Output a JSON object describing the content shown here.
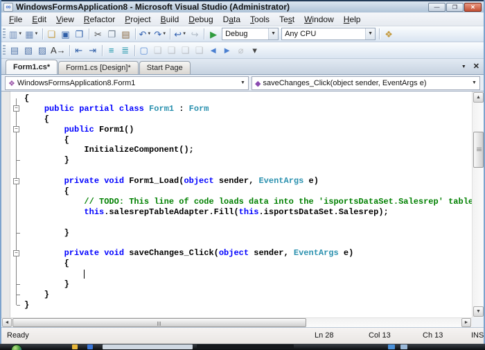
{
  "window": {
    "title": "WindowsFormsApplication8 - Microsoft Visual Studio (Administrator)",
    "logo_glyph": "∞",
    "controls": [
      {
        "name": "minimize-button",
        "glyph": "—"
      },
      {
        "name": "restore-button",
        "glyph": "❐"
      },
      {
        "name": "close-button",
        "glyph": "✕"
      }
    ]
  },
  "menubar": {
    "items": [
      {
        "label": "File",
        "u": 0
      },
      {
        "label": "Edit",
        "u": 0
      },
      {
        "label": "View",
        "u": 0
      },
      {
        "label": "Refactor",
        "u": 0
      },
      {
        "label": "Project",
        "u": 0
      },
      {
        "label": "Build",
        "u": 0
      },
      {
        "label": "Debug",
        "u": 0
      },
      {
        "label": "Data",
        "u": 1
      },
      {
        "label": "Tools",
        "u": 0
      },
      {
        "label": "Test",
        "u": 2
      },
      {
        "label": "Window",
        "u": 0
      },
      {
        "label": "Help",
        "u": 0
      }
    ]
  },
  "toolbar_main": {
    "items": [
      {
        "kind": "grip"
      },
      {
        "name": "new-project-button",
        "glyph": "▥",
        "color": "#6f8cb8",
        "dd": true
      },
      {
        "name": "add-new-item-button",
        "glyph": "▦",
        "color": "#6f8cb8",
        "dd": true
      },
      {
        "kind": "sep"
      },
      {
        "name": "open-file-button",
        "glyph": "❏",
        "color": "#c49a3e"
      },
      {
        "name": "save-button",
        "glyph": "▣",
        "color": "#2f5fa8"
      },
      {
        "name": "save-all-button",
        "glyph": "❐",
        "color": "#2f5fa8"
      },
      {
        "kind": "sep"
      },
      {
        "name": "cut-button",
        "glyph": "✂",
        "color": "#4a4a4a"
      },
      {
        "name": "copy-button",
        "glyph": "❐",
        "color": "#6a7a8a"
      },
      {
        "name": "paste-button",
        "glyph": "▤",
        "color": "#8a6a42"
      },
      {
        "kind": "sep"
      },
      {
        "name": "undo-button",
        "glyph": "↶",
        "color": "#2f5fb0",
        "dd": true
      },
      {
        "name": "redo-button",
        "glyph": "↷",
        "color": "#2f5fb0",
        "dd": true
      },
      {
        "kind": "sep"
      },
      {
        "name": "navigate-backward-button",
        "glyph": "↩",
        "color": "#2f5fb0",
        "dd": true
      },
      {
        "name": "navigate-forward-button",
        "glyph": "↪",
        "color": "#6a7a8a",
        "disabled": true
      },
      {
        "kind": "sep"
      },
      {
        "name": "start-debugging-button",
        "glyph": "▶",
        "color": "#2e9b3e"
      },
      {
        "kind": "combo",
        "name": "solution-configurations-combo",
        "value": "Debug",
        "width": 82
      },
      {
        "kind": "combo",
        "name": "solution-platforms-combo",
        "value": "Any CPU",
        "width": 136
      },
      {
        "kind": "sep"
      },
      {
        "name": "find-in-files-button",
        "glyph": "❖",
        "color": "#c49a3e"
      }
    ],
    "dd_glyph": "▼"
  },
  "toolbar_text_editor": {
    "items": [
      {
        "kind": "grip"
      },
      {
        "name": "display-member-list-button",
        "glyph": "▤",
        "color": "#5577aa"
      },
      {
        "name": "display-word-completion-button",
        "glyph": "▧",
        "color": "#5577aa"
      },
      {
        "name": "display-quick-info-button",
        "glyph": "▨",
        "color": "#5577aa"
      },
      {
        "name": "display-parameter-info-button",
        "glyph": "A→",
        "color": "#333333"
      },
      {
        "kind": "sep"
      },
      {
        "name": "decrease-indent-button",
        "glyph": "⇤",
        "color": "#2f5fa8"
      },
      {
        "name": "increase-indent-button",
        "glyph": "⇥",
        "color": "#2f5fa8"
      },
      {
        "kind": "sep"
      },
      {
        "name": "comment-selection-button",
        "glyph": "≡",
        "color": "#1a93a8"
      },
      {
        "name": "uncomment-selection-button",
        "glyph": "≣",
        "color": "#1a93a8"
      },
      {
        "kind": "sep"
      },
      {
        "name": "toggle-bookmark-button",
        "glyph": "▢",
        "color": "#5b8dd6"
      },
      {
        "name": "previous-bookmark-button",
        "glyph": "❑",
        "color": "#8a8a8a",
        "disabled": true
      },
      {
        "name": "next-bookmark-button",
        "glyph": "❑",
        "color": "#8a8a8a",
        "disabled": true
      },
      {
        "name": "previous-bookmark-in-folder-button",
        "glyph": "❑",
        "color": "#8a8a8a",
        "disabled": true
      },
      {
        "name": "next-bookmark-in-folder-button",
        "glyph": "❑",
        "color": "#8a8a8a",
        "disabled": true
      },
      {
        "name": "previous-bookmark-in-document-button",
        "glyph": "◄",
        "color": "#4a7fd0"
      },
      {
        "name": "next-bookmark-in-document-button",
        "glyph": "►",
        "color": "#4a7fd0"
      },
      {
        "name": "clear-bookmarks-button",
        "glyph": "⌀",
        "color": "#8a8a8a",
        "disabled": true
      },
      {
        "name": "toolbar-options-button",
        "glyph": "▾",
        "color": "#444444"
      }
    ]
  },
  "tabs": {
    "items": [
      {
        "label": "Form1.cs*",
        "active": true
      },
      {
        "label": "Form1.cs [Design]*",
        "active": false
      },
      {
        "label": "Start Page",
        "active": false
      }
    ],
    "dropdown_glyph": "▼",
    "close_glyph": "✕"
  },
  "navbar": {
    "types_icon": "❖",
    "types_value": "WindowsFormsApplication8.Form1",
    "members_icon": "◆",
    "members_value": "saveChanges_Click(object sender, EventArgs e)",
    "dd_glyph": "▼"
  },
  "editor": {
    "fold_glyph": "−",
    "lines": [
      {
        "segs": [
          [
            "sp",
            "{"
          ]
        ]
      },
      {
        "segs": [
          [
            "sp",
            "    "
          ],
          [
            "sk",
            "public partial class "
          ],
          [
            "st",
            "Form1"
          ],
          [
            "sp",
            " : "
          ],
          [
            "st",
            "Form"
          ]
        ]
      },
      {
        "segs": [
          [
            "sp",
            "    {"
          ]
        ]
      },
      {
        "segs": [
          [
            "sp",
            "        "
          ],
          [
            "sk",
            "public"
          ],
          [
            "sp",
            " Form1()"
          ]
        ]
      },
      {
        "segs": [
          [
            "sp",
            "        {"
          ]
        ]
      },
      {
        "segs": [
          [
            "sp",
            "            InitializeComponent();"
          ]
        ]
      },
      {
        "segs": [
          [
            "sp",
            "        }"
          ]
        ]
      },
      {
        "segs": []
      },
      {
        "segs": [
          [
            "sp",
            "        "
          ],
          [
            "sk",
            "private void"
          ],
          [
            "sp",
            " Form1_Load("
          ],
          [
            "sk",
            "object"
          ],
          [
            "sp",
            " sender, "
          ],
          [
            "st",
            "EventArgs"
          ],
          [
            "sp",
            " e)"
          ]
        ]
      },
      {
        "segs": [
          [
            "sp",
            "        {"
          ]
        ]
      },
      {
        "segs": [
          [
            "sc",
            "            // TODO: This line of code loads data into the 'isportsDataSet.Salesrep' table. Y"
          ]
        ]
      },
      {
        "segs": [
          [
            "sp",
            "            "
          ],
          [
            "sk",
            "this"
          ],
          [
            "sp",
            ".salesrepTableAdapter.Fill("
          ],
          [
            "sk",
            "this"
          ],
          [
            "sp",
            ".isportsDataSet.Salesrep);"
          ]
        ]
      },
      {
        "segs": []
      },
      {
        "segs": [
          [
            "sp",
            "        }"
          ]
        ]
      },
      {
        "segs": []
      },
      {
        "segs": [
          [
            "sp",
            "        "
          ],
          [
            "sk",
            "private void"
          ],
          [
            "sp",
            " saveChanges_Click("
          ],
          [
            "sk",
            "object"
          ],
          [
            "sp",
            " sender, "
          ],
          [
            "st",
            "EventArgs"
          ],
          [
            "sp",
            " e)"
          ]
        ]
      },
      {
        "segs": [
          [
            "sp",
            "        {"
          ]
        ]
      },
      {
        "segs": []
      },
      {
        "segs": [
          [
            "sp",
            "        }"
          ]
        ]
      },
      {
        "segs": [
          [
            "sp",
            "    }"
          ]
        ]
      },
      {
        "segs": [
          [
            "sp",
            "}"
          ]
        ]
      }
    ],
    "outline_boxes": [
      1,
      3,
      8,
      15
    ],
    "outline_ticks": [
      6,
      13,
      18,
      19,
      20
    ],
    "cursor": {
      "line_index": 17,
      "col": 13
    },
    "scrollbar": {
      "up": "▲",
      "down": "▼",
      "left": "◄",
      "right": "►"
    }
  },
  "statusbar": {
    "ready": "Ready",
    "line": "Ln 28",
    "col": "Col 13",
    "ch": "Ch 13",
    "mode": "INS"
  },
  "taskbar": {
    "items": [
      {
        "name": "tray-icon-1",
        "color": "#e8b73a"
      },
      {
        "name": "tray-icon-2",
        "color": "#3a76d8"
      },
      {
        "name": "taskbar-button-inactive",
        "color": "#cfd8e2"
      },
      {
        "name": "taskbar-button-active",
        "color": "#15181c"
      },
      {
        "name": "tray-icon-3",
        "color": "#4a90d8"
      },
      {
        "name": "tray-icon-4",
        "color": "#9ab8d8"
      }
    ]
  }
}
